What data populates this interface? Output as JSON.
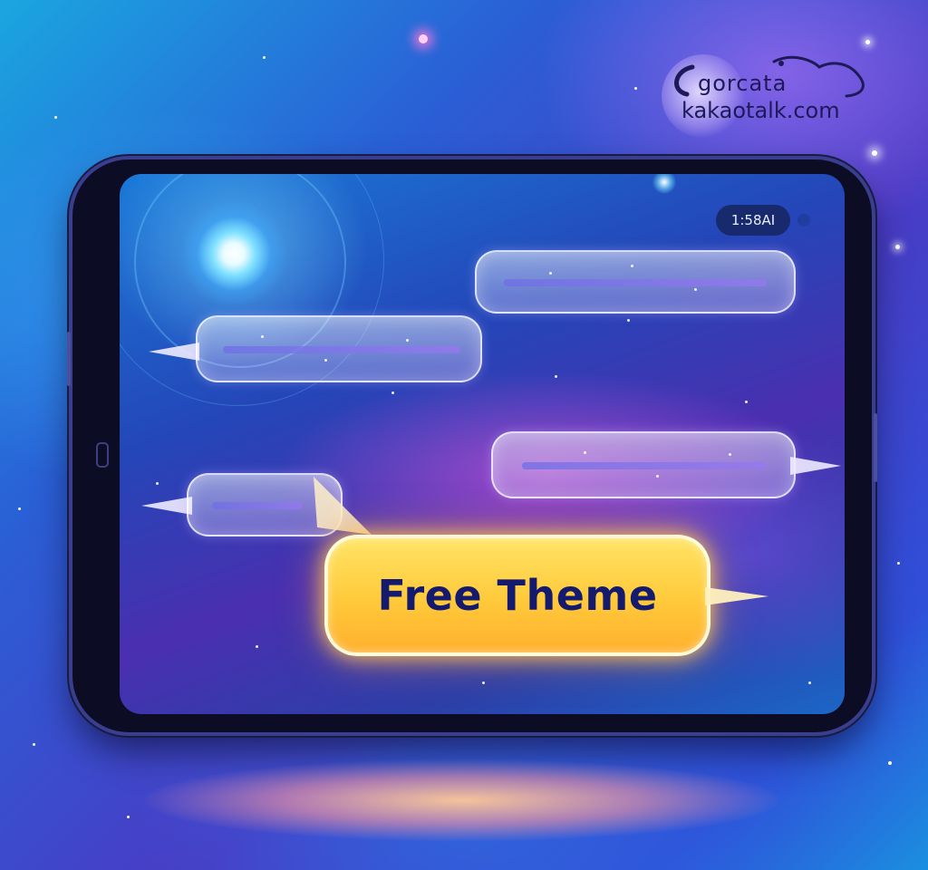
{
  "watermark": {
    "line1": "gorcata",
    "line2": "kakaotalk.com"
  },
  "status_bar": {
    "time_text": "1:58AI"
  },
  "cta": {
    "label": "Free Theme"
  },
  "icons": {
    "star": "star-sparkle-icon",
    "tail": "speech-bubble-tail-icon"
  },
  "colors": {
    "cta_fill": "#ffc93a",
    "cta_text": "#141a6e",
    "bubble_line": "#6e6ee6",
    "background_primary": "#2a5fd6"
  }
}
